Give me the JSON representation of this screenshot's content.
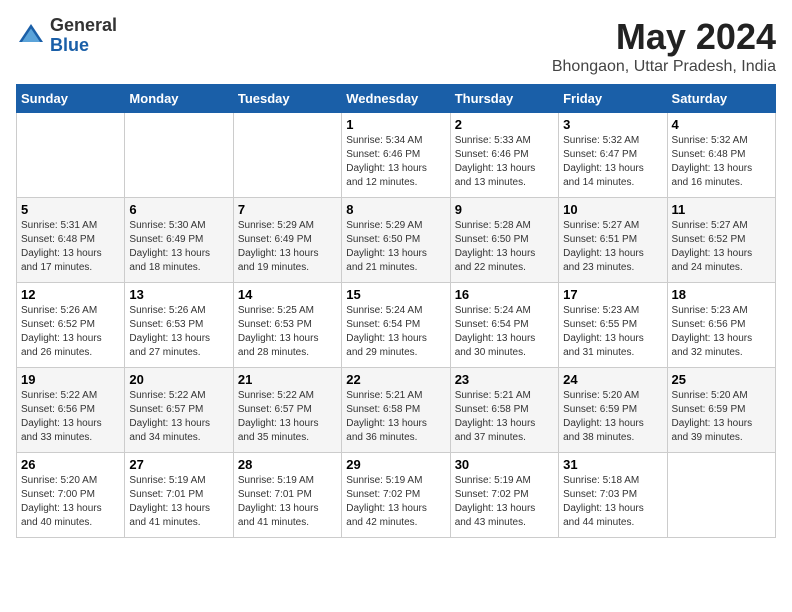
{
  "header": {
    "logo_general": "General",
    "logo_blue": "Blue",
    "month_year": "May 2024",
    "location": "Bhongaon, Uttar Pradesh, India"
  },
  "weekdays": [
    "Sunday",
    "Monday",
    "Tuesday",
    "Wednesday",
    "Thursday",
    "Friday",
    "Saturday"
  ],
  "weeks": [
    [
      {
        "day": "",
        "sunrise": "",
        "sunset": "",
        "daylight": ""
      },
      {
        "day": "",
        "sunrise": "",
        "sunset": "",
        "daylight": ""
      },
      {
        "day": "",
        "sunrise": "",
        "sunset": "",
        "daylight": ""
      },
      {
        "day": "1",
        "sunrise": "Sunrise: 5:34 AM",
        "sunset": "Sunset: 6:46 PM",
        "daylight": "Daylight: 13 hours and 12 minutes."
      },
      {
        "day": "2",
        "sunrise": "Sunrise: 5:33 AM",
        "sunset": "Sunset: 6:46 PM",
        "daylight": "Daylight: 13 hours and 13 minutes."
      },
      {
        "day": "3",
        "sunrise": "Sunrise: 5:32 AM",
        "sunset": "Sunset: 6:47 PM",
        "daylight": "Daylight: 13 hours and 14 minutes."
      },
      {
        "day": "4",
        "sunrise": "Sunrise: 5:32 AM",
        "sunset": "Sunset: 6:48 PM",
        "daylight": "Daylight: 13 hours and 16 minutes."
      }
    ],
    [
      {
        "day": "5",
        "sunrise": "Sunrise: 5:31 AM",
        "sunset": "Sunset: 6:48 PM",
        "daylight": "Daylight: 13 hours and 17 minutes."
      },
      {
        "day": "6",
        "sunrise": "Sunrise: 5:30 AM",
        "sunset": "Sunset: 6:49 PM",
        "daylight": "Daylight: 13 hours and 18 minutes."
      },
      {
        "day": "7",
        "sunrise": "Sunrise: 5:29 AM",
        "sunset": "Sunset: 6:49 PM",
        "daylight": "Daylight: 13 hours and 19 minutes."
      },
      {
        "day": "8",
        "sunrise": "Sunrise: 5:29 AM",
        "sunset": "Sunset: 6:50 PM",
        "daylight": "Daylight: 13 hours and 21 minutes."
      },
      {
        "day": "9",
        "sunrise": "Sunrise: 5:28 AM",
        "sunset": "Sunset: 6:50 PM",
        "daylight": "Daylight: 13 hours and 22 minutes."
      },
      {
        "day": "10",
        "sunrise": "Sunrise: 5:27 AM",
        "sunset": "Sunset: 6:51 PM",
        "daylight": "Daylight: 13 hours and 23 minutes."
      },
      {
        "day": "11",
        "sunrise": "Sunrise: 5:27 AM",
        "sunset": "Sunset: 6:52 PM",
        "daylight": "Daylight: 13 hours and 24 minutes."
      }
    ],
    [
      {
        "day": "12",
        "sunrise": "Sunrise: 5:26 AM",
        "sunset": "Sunset: 6:52 PM",
        "daylight": "Daylight: 13 hours and 26 minutes."
      },
      {
        "day": "13",
        "sunrise": "Sunrise: 5:26 AM",
        "sunset": "Sunset: 6:53 PM",
        "daylight": "Daylight: 13 hours and 27 minutes."
      },
      {
        "day": "14",
        "sunrise": "Sunrise: 5:25 AM",
        "sunset": "Sunset: 6:53 PM",
        "daylight": "Daylight: 13 hours and 28 minutes."
      },
      {
        "day": "15",
        "sunrise": "Sunrise: 5:24 AM",
        "sunset": "Sunset: 6:54 PM",
        "daylight": "Daylight: 13 hours and 29 minutes."
      },
      {
        "day": "16",
        "sunrise": "Sunrise: 5:24 AM",
        "sunset": "Sunset: 6:54 PM",
        "daylight": "Daylight: 13 hours and 30 minutes."
      },
      {
        "day": "17",
        "sunrise": "Sunrise: 5:23 AM",
        "sunset": "Sunset: 6:55 PM",
        "daylight": "Daylight: 13 hours and 31 minutes."
      },
      {
        "day": "18",
        "sunrise": "Sunrise: 5:23 AM",
        "sunset": "Sunset: 6:56 PM",
        "daylight": "Daylight: 13 hours and 32 minutes."
      }
    ],
    [
      {
        "day": "19",
        "sunrise": "Sunrise: 5:22 AM",
        "sunset": "Sunset: 6:56 PM",
        "daylight": "Daylight: 13 hours and 33 minutes."
      },
      {
        "day": "20",
        "sunrise": "Sunrise: 5:22 AM",
        "sunset": "Sunset: 6:57 PM",
        "daylight": "Daylight: 13 hours and 34 minutes."
      },
      {
        "day": "21",
        "sunrise": "Sunrise: 5:22 AM",
        "sunset": "Sunset: 6:57 PM",
        "daylight": "Daylight: 13 hours and 35 minutes."
      },
      {
        "day": "22",
        "sunrise": "Sunrise: 5:21 AM",
        "sunset": "Sunset: 6:58 PM",
        "daylight": "Daylight: 13 hours and 36 minutes."
      },
      {
        "day": "23",
        "sunrise": "Sunrise: 5:21 AM",
        "sunset": "Sunset: 6:58 PM",
        "daylight": "Daylight: 13 hours and 37 minutes."
      },
      {
        "day": "24",
        "sunrise": "Sunrise: 5:20 AM",
        "sunset": "Sunset: 6:59 PM",
        "daylight": "Daylight: 13 hours and 38 minutes."
      },
      {
        "day": "25",
        "sunrise": "Sunrise: 5:20 AM",
        "sunset": "Sunset: 6:59 PM",
        "daylight": "Daylight: 13 hours and 39 minutes."
      }
    ],
    [
      {
        "day": "26",
        "sunrise": "Sunrise: 5:20 AM",
        "sunset": "Sunset: 7:00 PM",
        "daylight": "Daylight: 13 hours and 40 minutes."
      },
      {
        "day": "27",
        "sunrise": "Sunrise: 5:19 AM",
        "sunset": "Sunset: 7:01 PM",
        "daylight": "Daylight: 13 hours and 41 minutes."
      },
      {
        "day": "28",
        "sunrise": "Sunrise: 5:19 AM",
        "sunset": "Sunset: 7:01 PM",
        "daylight": "Daylight: 13 hours and 41 minutes."
      },
      {
        "day": "29",
        "sunrise": "Sunrise: 5:19 AM",
        "sunset": "Sunset: 7:02 PM",
        "daylight": "Daylight: 13 hours and 42 minutes."
      },
      {
        "day": "30",
        "sunrise": "Sunrise: 5:19 AM",
        "sunset": "Sunset: 7:02 PM",
        "daylight": "Daylight: 13 hours and 43 minutes."
      },
      {
        "day": "31",
        "sunrise": "Sunrise: 5:18 AM",
        "sunset": "Sunset: 7:03 PM",
        "daylight": "Daylight: 13 hours and 44 minutes."
      },
      {
        "day": "",
        "sunrise": "",
        "sunset": "",
        "daylight": ""
      }
    ]
  ]
}
